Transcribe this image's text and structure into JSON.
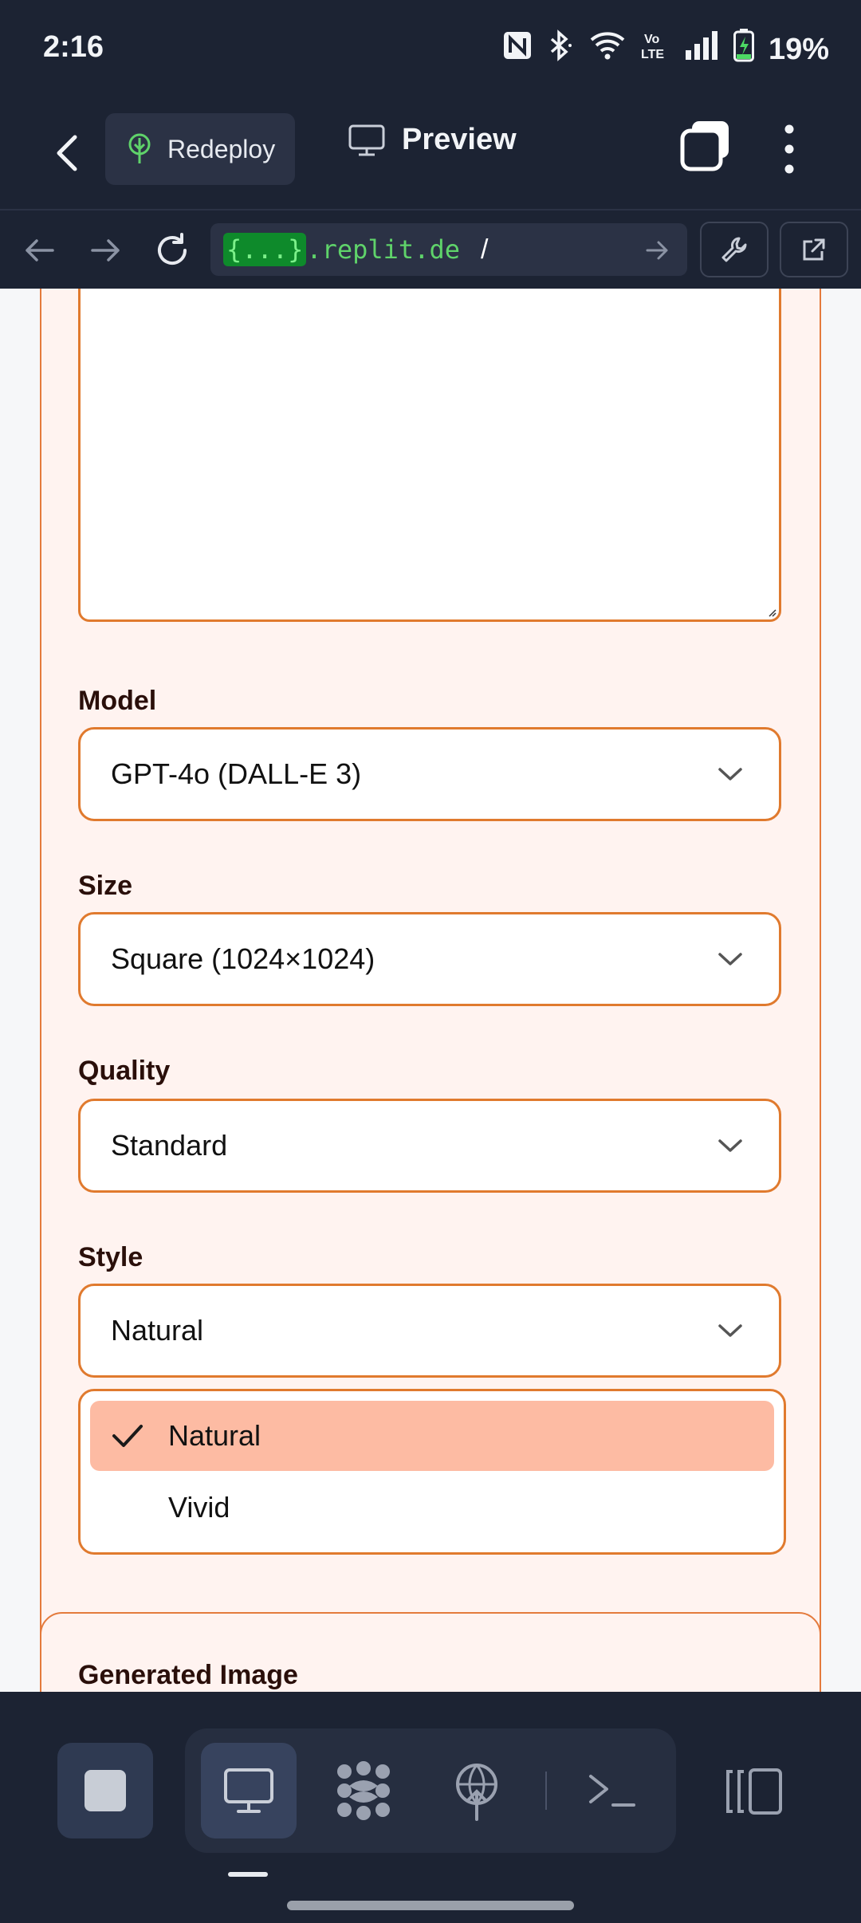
{
  "status_bar": {
    "time": "2:16",
    "battery": "19%",
    "icons": [
      "nfc-icon",
      "bluetooth-icon",
      "wifi-icon",
      "volte-icon",
      "signal-icon",
      "battery-charging-icon"
    ]
  },
  "toolbar": {
    "back_icon": "back-chevron-icon",
    "redeploy_label": "Redeploy",
    "preview_label": "Preview",
    "tabs_icon": "tabs-icon",
    "menu_icon": "kebab-menu-icon"
  },
  "urlbar": {
    "host_highlight": "{...}",
    "host_rest": ".replit.de",
    "path": "/"
  },
  "form": {
    "model_label": "Model",
    "model_value": "GPT-4o (DALL-E 3)",
    "size_label": "Size",
    "size_value": "Square (1024×1024)",
    "quality_label": "Quality",
    "quality_value": "Standard",
    "style_label": "Style",
    "style_value": "Natural",
    "style_options": [
      {
        "label": "Natural",
        "selected": true
      },
      {
        "label": "Vivid",
        "selected": false
      }
    ]
  },
  "result": {
    "title": "Generated Image"
  },
  "colors": {
    "accent_orange": "#e07a2e",
    "selected_option": "#fdbba3",
    "chrome_dark": "#1c2333",
    "url_green": "#5fd36a"
  }
}
